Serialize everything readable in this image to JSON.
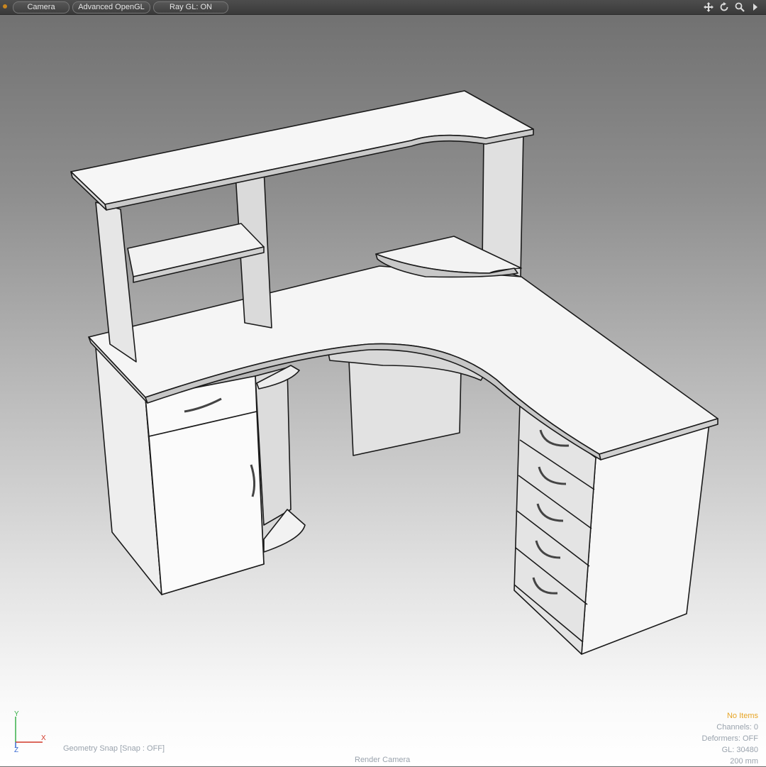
{
  "toolbar": {
    "menu_icon": "menu-dot-icon",
    "buttons": [
      "Camera",
      "Advanced OpenGL",
      "Ray GL: ON"
    ],
    "nav_icons": [
      "move-view-icon",
      "rotate-view-icon",
      "zoom-view-icon",
      "expand-arrow-icon"
    ]
  },
  "viewport": {
    "model": "corner computer desk",
    "axis_labels": {
      "y": "Y",
      "x": "X",
      "z": "Z"
    },
    "snap_status": "Geometry Snap  [Snap : OFF]",
    "camera_label": "Render Camera",
    "colors": {
      "selection_status": "#e6a425",
      "hud_text": "#9aa3ad",
      "axis_x": "#d23a2a",
      "axis_y": "#3ab04a",
      "axis_z": "#3a6ad2"
    }
  },
  "stats": {
    "items": "No Items",
    "channels": "Channels: 0",
    "deformers": "Deformers: OFF",
    "gl": "GL: 30480",
    "scale": "200 mm"
  }
}
